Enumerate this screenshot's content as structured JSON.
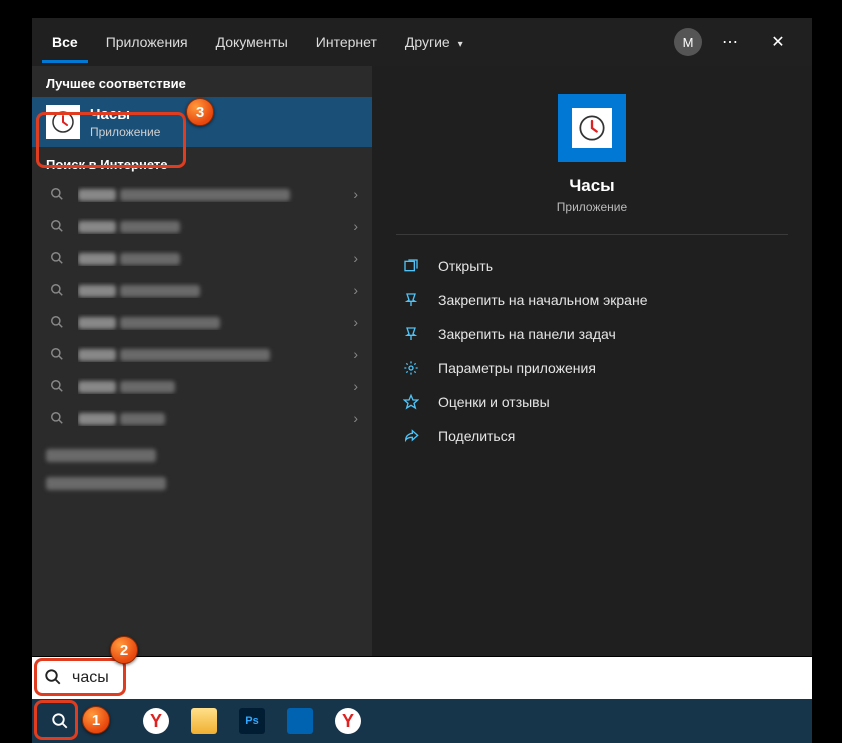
{
  "header": {
    "tabs": [
      {
        "label": "Все",
        "active": true
      },
      {
        "label": "Приложения"
      },
      {
        "label": "Документы"
      },
      {
        "label": "Интернет"
      },
      {
        "label": "Другие",
        "dropdown": true
      }
    ],
    "avatar_letter": "M"
  },
  "left": {
    "best_match_header": "Лучшее соответствие",
    "best_match": {
      "title": "Часы",
      "subtitle": "Приложение"
    },
    "web_header": "Поиск в Интернете",
    "web_items": [
      "часы — См. результаты в Интернете",
      "часы и регион",
      "часы на экран",
      "часы и будильник",
      "часы язык и регион",
      "часы на экран windows 10",
      "часы онлайн",
      "часы polar"
    ],
    "extra": [
      "Параметры (9)",
      "Фотографии (5+)"
    ]
  },
  "right": {
    "title": "Часы",
    "subtitle": "Приложение",
    "actions": [
      {
        "icon": "open",
        "label": "Открыть"
      },
      {
        "icon": "pin-start",
        "label": "Закрепить на начальном экране"
      },
      {
        "icon": "pin-taskbar",
        "label": "Закрепить на панели задач"
      },
      {
        "icon": "settings",
        "label": "Параметры приложения"
      },
      {
        "icon": "rate",
        "label": "Оценки и отзывы"
      },
      {
        "icon": "share",
        "label": "Поделиться"
      }
    ]
  },
  "search": {
    "value": "часы"
  },
  "taskbar": {
    "items": [
      "search",
      "browser-y",
      "file-explorer",
      "photoshop",
      "calendar",
      "browser-y-2"
    ]
  },
  "annotations": {
    "b1": "1",
    "b2": "2",
    "b3": "3"
  }
}
